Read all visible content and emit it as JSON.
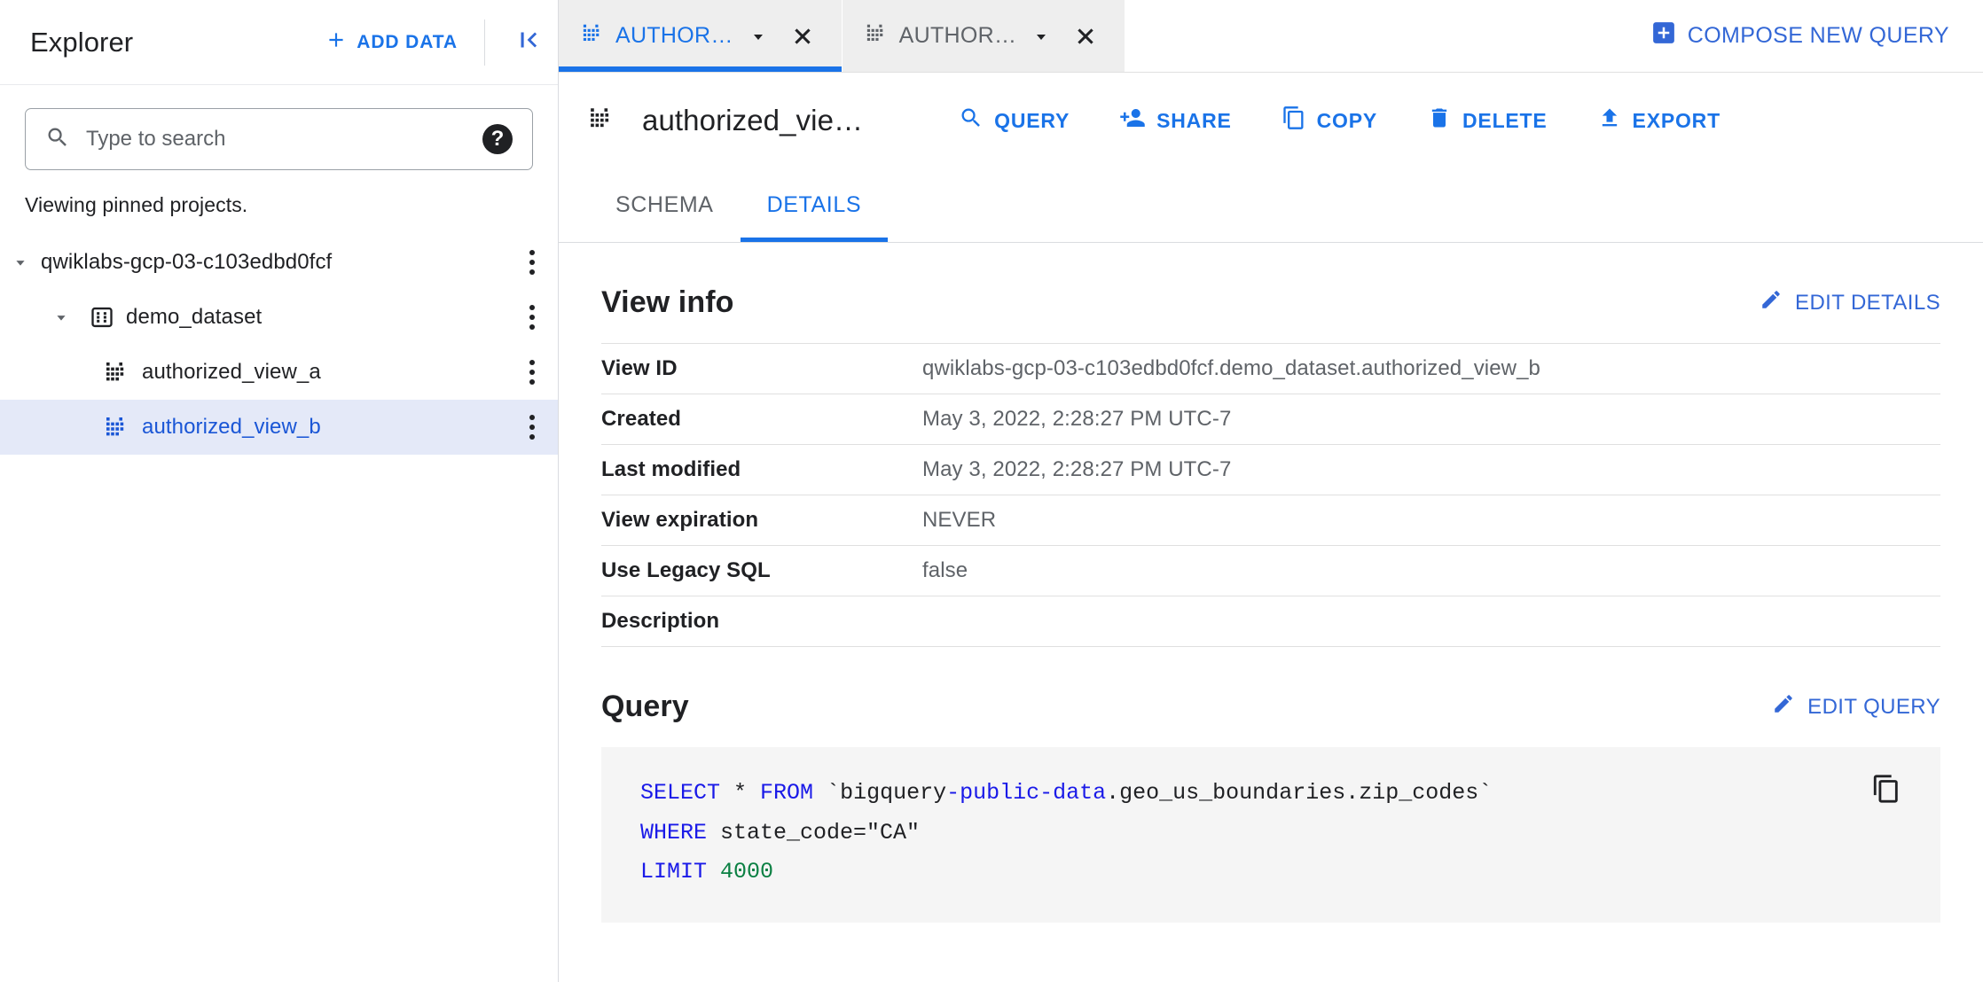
{
  "sidebar": {
    "title": "Explorer",
    "add_data_label": "ADD DATA",
    "collapse_icon": "collapse-panel-icon",
    "search": {
      "placeholder": "Type to search",
      "value": "",
      "icon": "search-icon",
      "help_icon": "help-circle-icon"
    },
    "pinned_note": "Viewing pinned projects.",
    "tree": [
      {
        "label": "qwiklabs-gcp-03-c103edbd0fcf",
        "type": "project",
        "expanded": true,
        "selected": false,
        "icon": "caret-down-icon"
      },
      {
        "label": "demo_dataset",
        "type": "dataset",
        "expanded": true,
        "selected": false,
        "icon": "dataset-icon"
      },
      {
        "label": "authorized_view_a",
        "type": "view",
        "expanded": false,
        "selected": false,
        "icon": "view-icon"
      },
      {
        "label": "authorized_view_b",
        "type": "view",
        "expanded": false,
        "selected": true,
        "icon": "view-icon"
      }
    ],
    "more_menu_label": "more-options"
  },
  "tabstrip": {
    "tabs": [
      {
        "label": "AUTHOR…",
        "active": true,
        "icon": "view-icon",
        "caret": "chevron-down-icon",
        "close": "close-icon"
      },
      {
        "label": "AUTHOR…",
        "active": false,
        "icon": "view-icon",
        "caret": "chevron-down-icon",
        "close": "close-icon"
      }
    ],
    "compose_label": "COMPOSE NEW QUERY",
    "compose_icon": "add-box-icon"
  },
  "toolbar": {
    "view_icon": "view-icon",
    "view_title": "authorized_vie…",
    "actions": [
      {
        "label": "QUERY",
        "icon": "search-icon"
      },
      {
        "label": "SHARE",
        "icon": "person-add-icon"
      },
      {
        "label": "COPY",
        "icon": "copy-icon"
      },
      {
        "label": "DELETE",
        "icon": "trash-icon"
      },
      {
        "label": "EXPORT",
        "icon": "export-upload-icon"
      }
    ]
  },
  "detail_tabs": [
    {
      "label": "SCHEMA",
      "active": false
    },
    {
      "label": "DETAILS",
      "active": true
    }
  ],
  "view_info": {
    "title": "View info",
    "edit_label": "EDIT DETAILS",
    "edit_icon": "pencil-icon",
    "rows": [
      {
        "key": "View ID",
        "value": "qwiklabs-gcp-03-c103edbd0fcf.demo_dataset.authorized_view_b"
      },
      {
        "key": "Created",
        "value": "May 3, 2022, 2:28:27 PM UTC-7"
      },
      {
        "key": "Last modified",
        "value": "May 3, 2022, 2:28:27 PM UTC-7"
      },
      {
        "key": "View expiration",
        "value": "NEVER"
      },
      {
        "key": "Use Legacy SQL",
        "value": "false"
      },
      {
        "key": "Description",
        "value": ""
      }
    ]
  },
  "query_section": {
    "title": "Query",
    "edit_label": "EDIT QUERY",
    "edit_icon": "pencil-icon",
    "copy_icon": "copy-icon",
    "sql": {
      "line1_kw1": "SELECT",
      "line1_star": " * ",
      "line1_kw2": "FROM",
      "line1_tick_open": " `",
      "line1_proj_a": "bigquery",
      "line1_dash1": "-",
      "line1_proj_b": "public",
      "line1_dash2": "-",
      "line1_proj_c": "data",
      "line1_rest": ".geo_us_boundaries.zip_codes`",
      "line2_kw": "WHERE",
      "line2_rest": " state_code=\"CA\"",
      "line3_kw": "LIMIT",
      "line3_num": " 4000"
    }
  },
  "colors": {
    "accent": "#1a73e8",
    "accent_dark": "#3367d6",
    "selected_row_bg": "#e4e9f8",
    "sql_keyword": "#1a1ae8",
    "sql_number": "#0b8043",
    "sql_bg": "#f5f5f5",
    "text_primary": "#202124",
    "text_secondary": "#5f6368"
  }
}
